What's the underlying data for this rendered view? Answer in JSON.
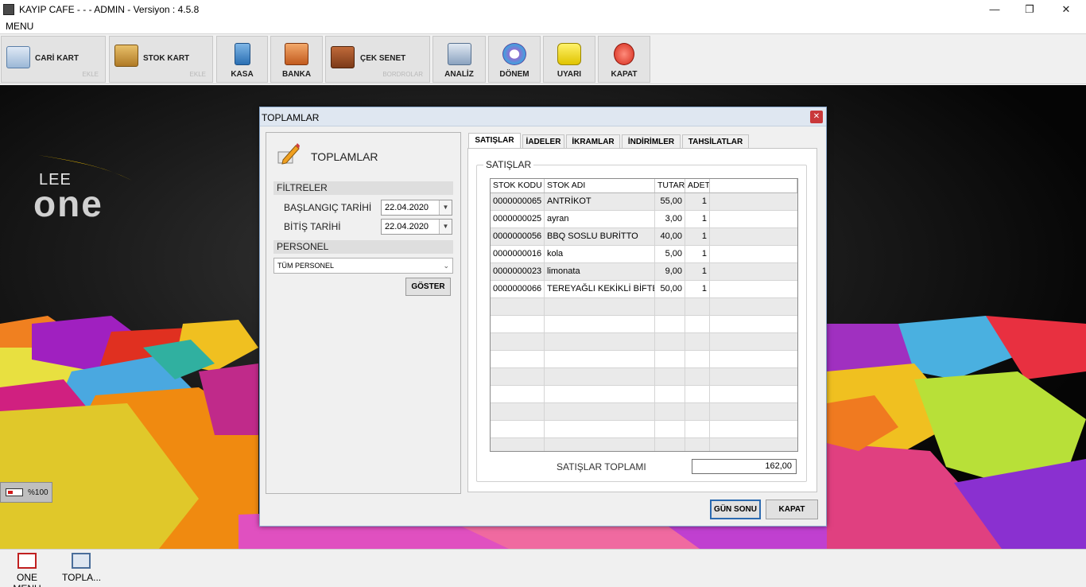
{
  "window": {
    "title": "KAYIP CAFE -  -  - ADMIN -  Versiyon : 4.5.8",
    "min": "—",
    "max": "❐",
    "close": "✕"
  },
  "menu": {
    "label": "MENU"
  },
  "toolbar": {
    "cari_kart": {
      "label": "CARİ KART",
      "sub": "EKLE"
    },
    "stok_kart": {
      "label": "STOK KART",
      "sub": "EKLE"
    },
    "kasa": "KASA",
    "banka": "BANKA",
    "cek_senet": {
      "label": "ÇEK SENET",
      "sub": "BORDROLAR"
    },
    "analiz": "ANALİZ",
    "donem": "DÖNEM",
    "uyari": "UYARI",
    "kapat": "KAPAT"
  },
  "desktop": {
    "logo_top": "LEE",
    "logo_bottom": "one",
    "battery": "%100"
  },
  "dialog": {
    "title": "TOPLAMLAR",
    "close": "✕",
    "left": {
      "title": "TOPLAMLAR",
      "filters_header": "FİLTRELER",
      "start_label": "BAŞLANGIÇ TARİHİ",
      "start_value": "22.04.2020",
      "end_label": "BİTİŞ TARİHİ",
      "end_value": "22.04.2020",
      "personel_header": "PERSONEL",
      "personel_value": "TÜM PERSONEL",
      "show_button": "GÖSTER"
    },
    "tabs": [
      "SATIŞLAR",
      "İADELER",
      "İKRAMLAR",
      "İNDİRİMLER",
      "TAHSİLATLAR"
    ],
    "group_title": "SATIŞLAR",
    "grid": {
      "columns": [
        "STOK KODU",
        "STOK ADI",
        "TUTAR",
        "ADET",
        ""
      ],
      "rows": [
        [
          "0000000065",
          "ANTRİKOT",
          "55,00",
          "1"
        ],
        [
          "0000000025",
          "ayran",
          "3,00",
          "1"
        ],
        [
          "0000000056",
          "BBQ SOSLU BURİTTO",
          "40,00",
          "1"
        ],
        [
          "0000000016",
          "kola",
          "5,00",
          "1"
        ],
        [
          "0000000023",
          "limonata",
          "9,00",
          "1"
        ],
        [
          "0000000066",
          "TEREYAĞLI KEKİKLİ BİFTEK",
          "50,00",
          "1"
        ]
      ]
    },
    "total_label": "SATIŞLAR TOPLAMI",
    "total_value": "162,00",
    "buttons": {
      "gun_sonu": "GÜN SONU",
      "kapat": "KAPAT"
    }
  },
  "taskbar": [
    {
      "label": "ONE MENU"
    },
    {
      "label": "TOPLA..."
    }
  ]
}
